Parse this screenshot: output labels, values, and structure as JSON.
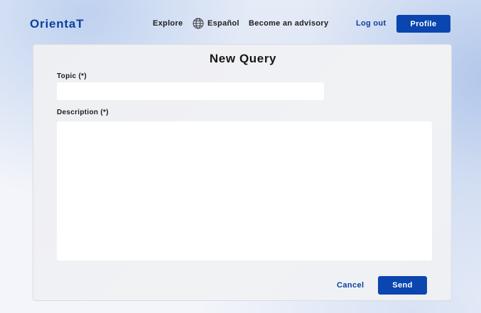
{
  "header": {
    "logo": "OrientaT",
    "nav": {
      "explore": "Explore",
      "language": "Español",
      "language_icon": "globe-icon",
      "advisory": "Become an advisory"
    },
    "logout": "Log out",
    "profile": "Profile"
  },
  "form": {
    "title": "New Query",
    "topic_label": "Topic (*)",
    "topic_value": "",
    "description_label": "Description (*)",
    "description_value": "",
    "cancel": "Cancel",
    "send": "Send"
  },
  "colors": {
    "brand": "#0b3f9e",
    "primary_button": "#0a45b0"
  }
}
